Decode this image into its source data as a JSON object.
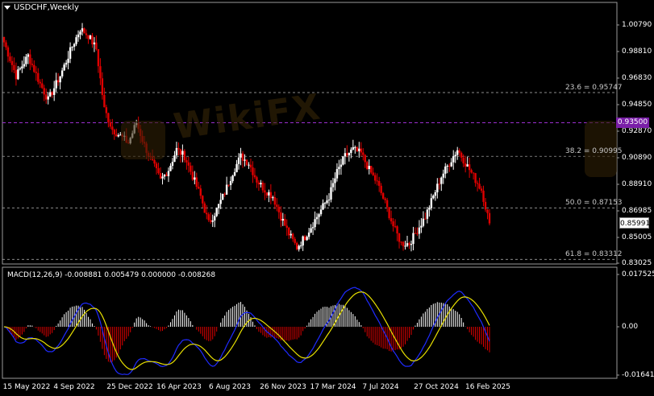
{
  "header": {
    "symbol_title": "USDCHF,Weekly"
  },
  "price_axis": {
    "ticks": [
      "1.00790",
      "0.98810",
      "0.96830",
      "0.94850",
      "0.92870",
      "0.90890",
      "0.88910",
      "0.86985",
      "0.85005",
      "0.83025"
    ],
    "current_price": "0.85991",
    "level_badge": "0.93500"
  },
  "fibonacci": [
    {
      "label": "23.6 = 0.95747",
      "price": 0.95747
    },
    {
      "label": "38.2 = 0.90995",
      "price": 0.90995
    },
    {
      "label": "50.0 = 0.87153",
      "price": 0.87153
    },
    {
      "label": "61.8 = 0.83312",
      "price": 0.83312
    }
  ],
  "indicator": {
    "label": "MACD(12,26,9) -0.008881 0.005479 0.000000 -0.008268",
    "ticks": [
      "0.017525",
      "0.00",
      "-0.016419"
    ]
  },
  "time_axis": {
    "labels": [
      "15 May 2022",
      "4 Sep 2022",
      "25 Dec 2022",
      "16 Apr 2023",
      "6 Aug 2023",
      "26 Nov 2023",
      "17 Mar 2024",
      "7 Jul 2024",
      "27 Oct 2024",
      "16 Feb 2025"
    ]
  },
  "watermark": "WikiFX",
  "colors": {
    "background": "#000000",
    "bull": "#ffffff",
    "bear": "#e00000",
    "macd_line": "#1f2bff",
    "signal_line": "#e8e000",
    "level_line": "#9b2fd0",
    "fib_line": "#bbbbbb"
  },
  "chart_data": {
    "type": "candlestick",
    "symbol": "USDCHF",
    "timeframe": "Weekly",
    "x_range": [
      "15 May 2022",
      "16 Feb 2025"
    ],
    "ylim": [
      0.83025,
      1.0079
    ],
    "close_path": [
      [
        0,
        0.995
      ],
      [
        6,
        0.97
      ],
      [
        12,
        0.985
      ],
      [
        18,
        0.964
      ],
      [
        22,
        0.952
      ],
      [
        28,
        0.97
      ],
      [
        34,
        0.992
      ],
      [
        38,
        1.005
      ],
      [
        42,
        1.0
      ],
      [
        46,
        0.99
      ],
      [
        50,
        0.945
      ],
      [
        54,
        0.93
      ],
      [
        58,
        0.925
      ],
      [
        62,
        0.92
      ],
      [
        66,
        0.935
      ],
      [
        70,
        0.918
      ],
      [
        74,
        0.905
      ],
      [
        78,
        0.892
      ],
      [
        82,
        0.9
      ],
      [
        86,
        0.915
      ],
      [
        90,
        0.91
      ],
      [
        94,
        0.895
      ],
      [
        98,
        0.88
      ],
      [
        102,
        0.86
      ],
      [
        106,
        0.87
      ],
      [
        110,
        0.883
      ],
      [
        114,
        0.898
      ],
      [
        118,
        0.91
      ],
      [
        122,
        0.905
      ],
      [
        126,
        0.892
      ],
      [
        130,
        0.885
      ],
      [
        134,
        0.88
      ],
      [
        138,
        0.865
      ],
      [
        142,
        0.852
      ],
      [
        146,
        0.842
      ],
      [
        150,
        0.85
      ],
      [
        154,
        0.86
      ],
      [
        158,
        0.87
      ],
      [
        162,
        0.88
      ],
      [
        166,
        0.898
      ],
      [
        170,
        0.91
      ],
      [
        174,
        0.915
      ],
      [
        178,
        0.912
      ],
      [
        182,
        0.9
      ],
      [
        186,
        0.89
      ],
      [
        190,
        0.875
      ],
      [
        194,
        0.858
      ],
      [
        198,
        0.845
      ],
      [
        202,
        0.845
      ],
      [
        206,
        0.855
      ],
      [
        210,
        0.865
      ],
      [
        214,
        0.88
      ],
      [
        218,
        0.895
      ],
      [
        222,
        0.905
      ],
      [
        226,
        0.915
      ],
      [
        230,
        0.905
      ],
      [
        234,
        0.895
      ],
      [
        238,
        0.885
      ],
      [
        242,
        0.86
      ]
    ],
    "macd_range": [
      -0.016419,
      0.017525
    ],
    "macd_last": {
      "histogram": -0.008881,
      "signal": 0.005479,
      "macd": -0.008268
    }
  }
}
